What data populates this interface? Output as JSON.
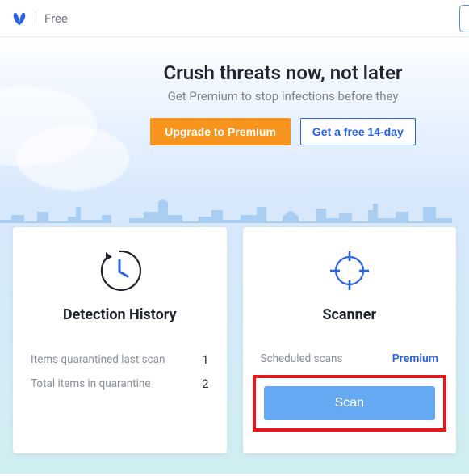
{
  "header": {
    "edition": "Free"
  },
  "hero": {
    "title": "Crush threats now, not later",
    "subtitle": "Get Premium to stop infections before they",
    "upgrade_label": "Upgrade to Premium",
    "trial_label": "Get a free 14-day"
  },
  "cards": {
    "history": {
      "title": "Detection History",
      "rows": [
        {
          "label": "Items quarantined last scan",
          "value": "1"
        },
        {
          "label": "Total items in quarantine",
          "value": "2"
        }
      ]
    },
    "scanner": {
      "title": "Scanner",
      "scheduled_label": "Scheduled scans",
      "scheduled_value": "Premium",
      "scan_label": "Scan"
    }
  }
}
